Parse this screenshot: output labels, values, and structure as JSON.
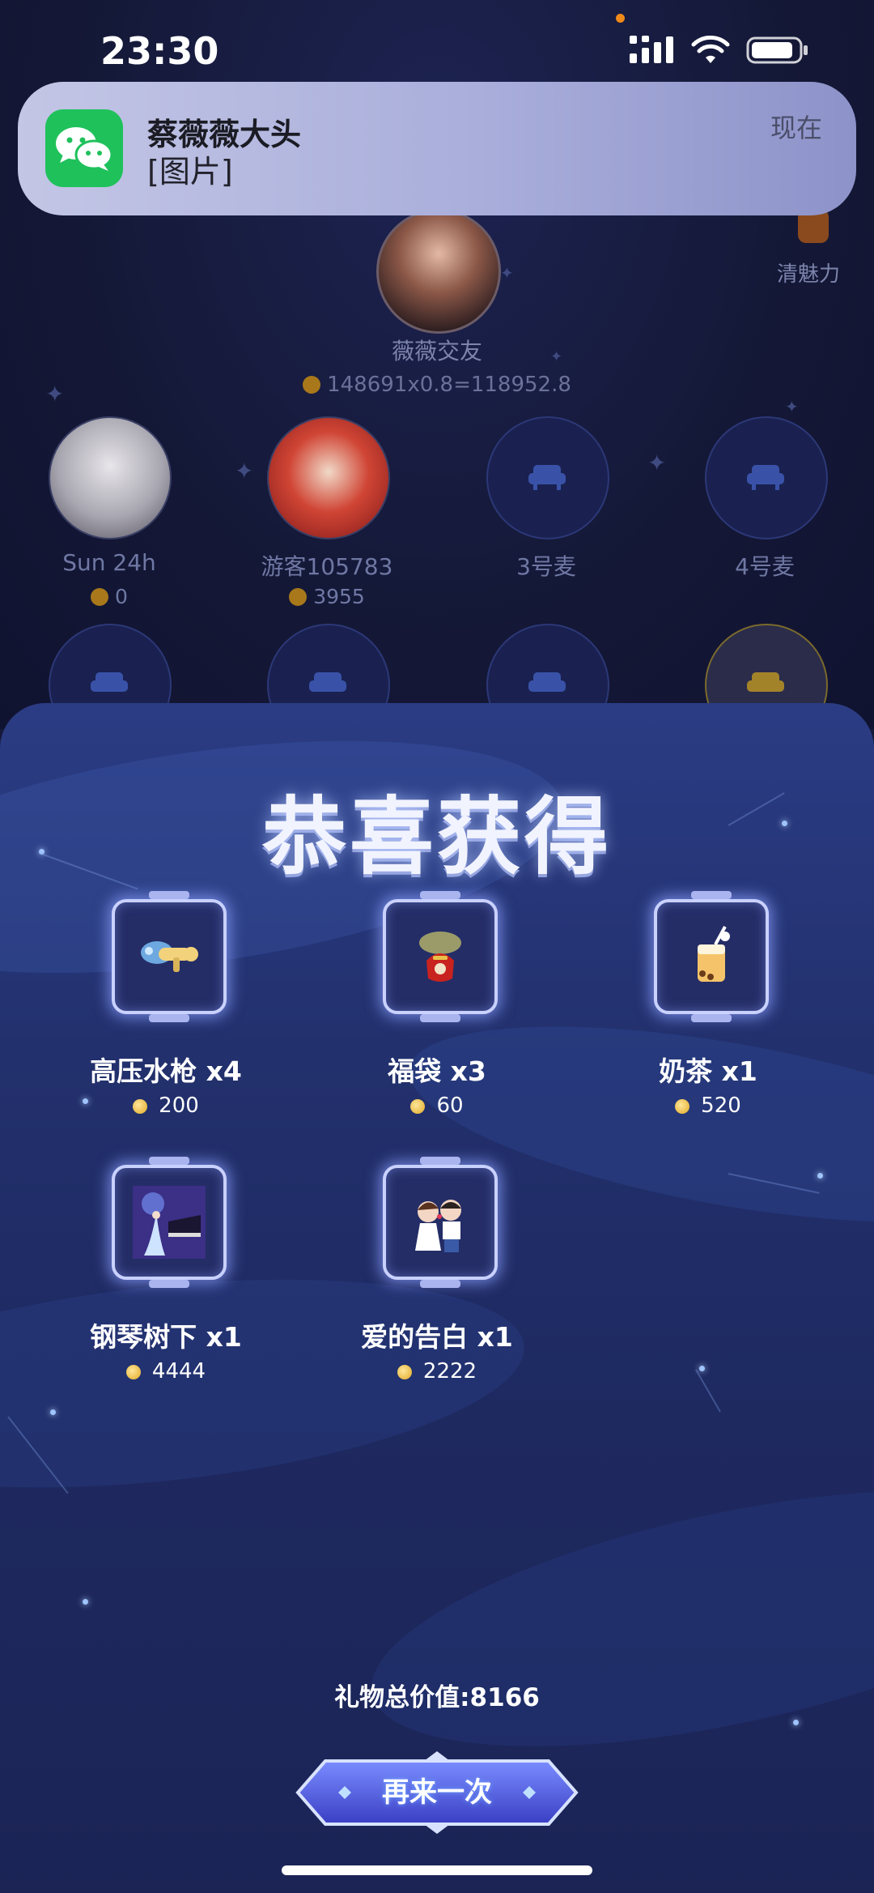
{
  "status_bar": {
    "time": "23:30"
  },
  "notification": {
    "app_icon": "wechat-icon",
    "title": "蔡薇薇大头",
    "body": "[图片]",
    "time": "现在"
  },
  "room": {
    "host": {
      "name": "薇薇交友",
      "score": "148691x0.8=118952.8"
    },
    "charm_label": "清魅力",
    "seats": [
      {
        "name": "Sun 24h",
        "coins": "0"
      },
      {
        "name": "游客105783",
        "coins": "3955"
      },
      {
        "name": "3号麦"
      },
      {
        "name": "4号麦"
      }
    ]
  },
  "modal": {
    "title": "恭喜获得",
    "gifts": [
      {
        "name": "高压水枪 x4",
        "price": "200",
        "icon": "water-gun-icon"
      },
      {
        "name": "福袋 x3",
        "price": "60",
        "icon": "lucky-bag-icon"
      },
      {
        "name": "奶茶 x1",
        "price": "520",
        "icon": "milk-tea-icon"
      },
      {
        "name": "钢琴树下 x1",
        "price": "4444",
        "icon": "piano-icon"
      },
      {
        "name": "爱的告白 x1",
        "price": "2222",
        "icon": "couple-kiss-icon"
      }
    ],
    "total": "礼物总价值:8166",
    "again_button": "再来一次"
  }
}
